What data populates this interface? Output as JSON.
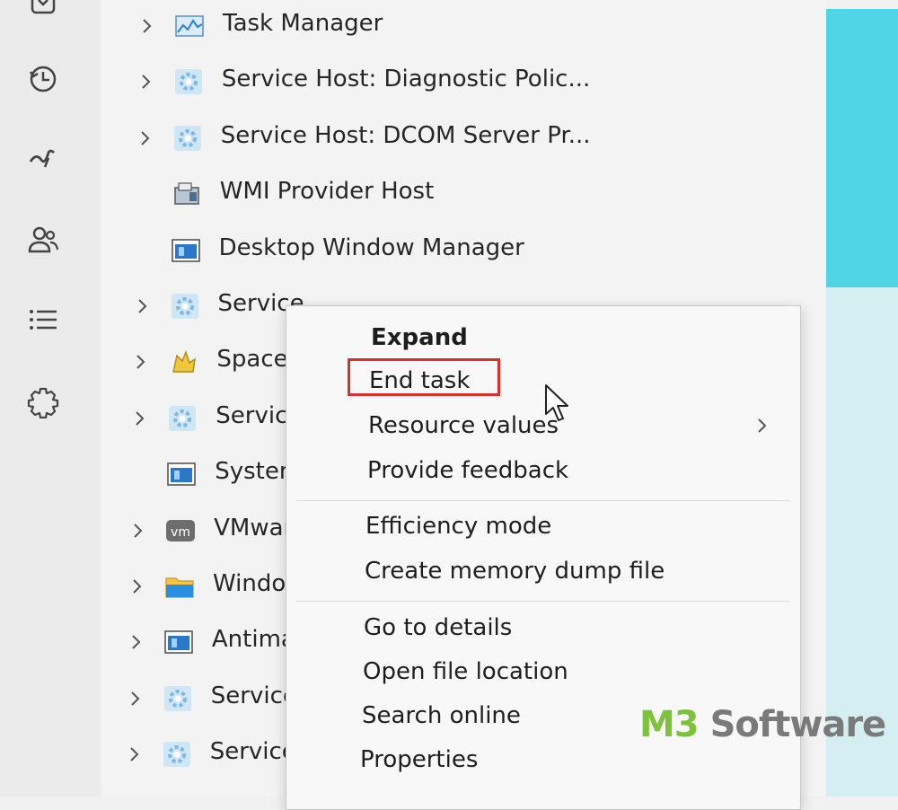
{
  "nav_rail": {
    "icons": [
      "app-history-icon",
      "startup-apps-icon",
      "users-icon",
      "details-icon",
      "services-icon"
    ]
  },
  "processes": [
    {
      "name": "Task Manager",
      "expandable": true,
      "icon": "task-manager-icon"
    },
    {
      "name": "Service Host: Diagnostic Polic...",
      "expandable": true,
      "icon": "gear-icon"
    },
    {
      "name": "Service Host: DCOM Server Pr...",
      "expandable": true,
      "icon": "gear-icon"
    },
    {
      "name": "WMI Provider Host",
      "expandable": false,
      "icon": "wmi-icon"
    },
    {
      "name": "Desktop Window Manager",
      "expandable": false,
      "icon": "window-icon"
    },
    {
      "name": "Service",
      "expandable": true,
      "icon": "gear-icon"
    },
    {
      "name": "SpaceS",
      "expandable": true,
      "icon": "spacesniffer-icon"
    },
    {
      "name": "Service",
      "expandable": true,
      "icon": "gear-icon"
    },
    {
      "name": "System",
      "expandable": false,
      "icon": "window-icon"
    },
    {
      "name": "VMwar",
      "expandable": true,
      "icon": "vmware-icon"
    },
    {
      "name": "Windov",
      "expandable": true,
      "icon": "folder-icon"
    },
    {
      "name": "Antima",
      "expandable": true,
      "icon": "window-icon"
    },
    {
      "name": "Service",
      "expandable": true,
      "icon": "gear-icon"
    },
    {
      "name": "Service",
      "expandable": true,
      "icon": "gear-icon"
    }
  ],
  "context_menu": {
    "items": [
      {
        "label": "Expand",
        "bold": true
      },
      {
        "label": "End task",
        "highlighted": true
      },
      {
        "label": "Resource values",
        "submenu": true
      },
      {
        "label": "Provide feedback"
      },
      {
        "label": "Efficiency mode"
      },
      {
        "label": "Create memory dump file"
      },
      {
        "label": "Go to details"
      },
      {
        "label": "Open file location"
      },
      {
        "label": "Search online"
      },
      {
        "label": "Properties"
      }
    ]
  },
  "watermark": {
    "part1": "M3",
    "part2": " Software"
  },
  "colors": {
    "highlight_box": "#d9302c",
    "accent_cyan": "#4fd5e6",
    "watermark_green": "#7cc33b"
  }
}
